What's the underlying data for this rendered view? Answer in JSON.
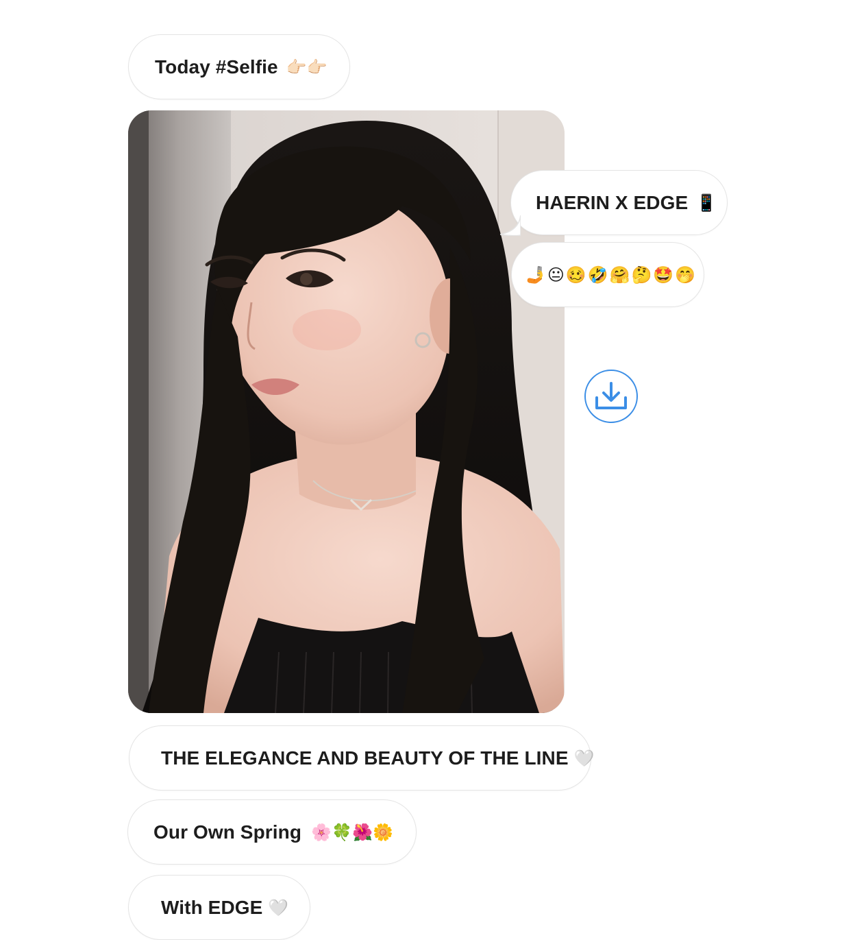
{
  "messages": {
    "m1": {
      "text": "Today #Selfie",
      "emoji": "👉🏻👉🏻"
    },
    "m2": {
      "text": "HAERIN X EDGE",
      "emoji": "📱"
    },
    "m3": {
      "emoji": "🤳😐🥴🤣🤗🤔🤩🤭"
    },
    "m4": {
      "text": "THE ELEGANCE AND BEAUTY OF THE LINE",
      "emoji": "🤍"
    },
    "m5": {
      "text": "Our Own Spring",
      "emoji": "🌸🍀🌺🌼"
    },
    "m6": {
      "text": "With EDGE",
      "emoji": "🤍"
    }
  },
  "photo": {
    "subject": "selfie-photo"
  },
  "download": {
    "icon": "download-icon",
    "color": "#3b8ee6"
  }
}
